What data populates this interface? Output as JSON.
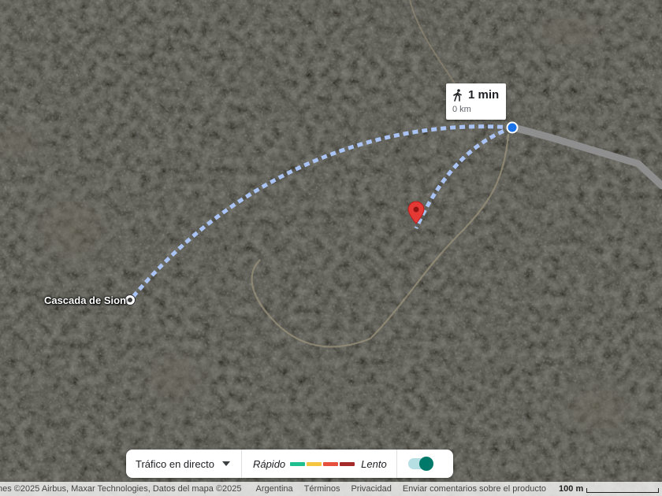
{
  "map": {
    "view": "satellite",
    "place_label": "Cascada de Sion",
    "route_line_color": "#a9c3f5",
    "origin_color": "#1a73e8",
    "destination_pin_color": "#e53935",
    "road_color": "#8e8e8e"
  },
  "route_card": {
    "mode_icon": "walking-person-icon",
    "duration": "1 min",
    "distance": "0 km"
  },
  "traffic": {
    "selector_label": "Tráfico en directo",
    "fast_label": "Rápido",
    "slow_label": "Lento",
    "swatch_colors": [
      "#1fbf8f",
      "#f5c542",
      "#e8503e",
      "#a52a2a"
    ],
    "toggle_on": true
  },
  "footer": {
    "attribution": "nes ©2025 Airbus, Maxar Technologies, Datos del mapa ©2025",
    "links": [
      "Argentina",
      "Términos",
      "Privacidad",
      "Enviar comentarios sobre el producto"
    ],
    "scale_label": "100 m"
  }
}
